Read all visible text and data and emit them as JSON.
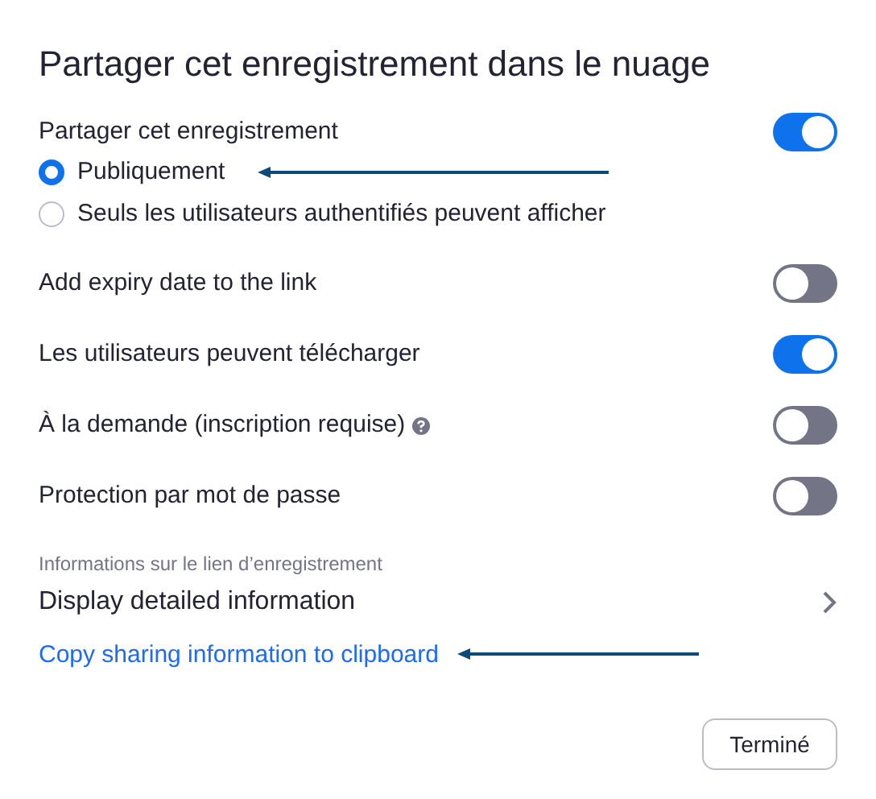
{
  "title": "Partager cet enregistrement dans le nuage",
  "share": {
    "label": "Partager cet enregistrement",
    "on": true,
    "options": [
      {
        "label": "Publiquement",
        "selected": true
      },
      {
        "label": "Seuls les utilisateurs authentifiés peuvent afficher",
        "selected": false
      }
    ]
  },
  "settings": [
    {
      "label": "Add expiry date to the link",
      "on": false
    },
    {
      "label": "Les utilisateurs peuvent télécharger",
      "on": true
    },
    {
      "label": "À la demande (inscription requise)",
      "on": false,
      "help": true
    },
    {
      "label": "Protection par mot de passe",
      "on": false
    }
  ],
  "link_section": {
    "heading": "Informations sur le lien d’enregistrement",
    "detail": "Display detailed information",
    "copy_link": "Copy sharing information to clipboard"
  },
  "done_button": "Terminé"
}
